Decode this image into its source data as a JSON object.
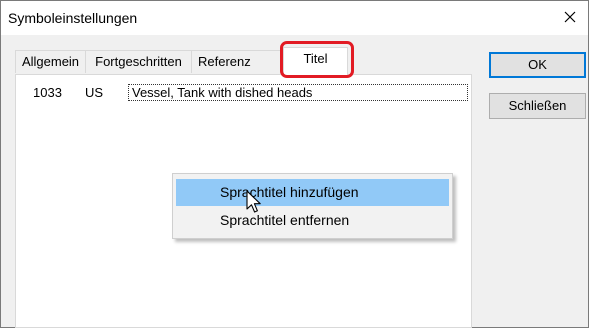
{
  "window": {
    "title": "Symboleinstellungen",
    "close_glyph": "✕"
  },
  "tabs": [
    {
      "label": "Allgemein"
    },
    {
      "label": "Fortgeschritten"
    },
    {
      "label": "Referenz"
    },
    {
      "label": "Titel"
    }
  ],
  "active_tab": "Titel",
  "highlight_color": "#e21b24",
  "titles_list": {
    "rows": [
      {
        "code": "1033",
        "language": "US",
        "title": "Vessel, Tank with dished heads"
      }
    ]
  },
  "buttons": {
    "ok_label": "OK",
    "close_label": "Schließen"
  },
  "context_menu": {
    "items": [
      {
        "label": "Sprachtitel hinzufügen",
        "hovered": true
      },
      {
        "label": "Sprachtitel entfernen",
        "hovered": false
      }
    ]
  },
  "icons": {
    "close": "close-icon",
    "cursor": "mouse-pointer-icon"
  }
}
